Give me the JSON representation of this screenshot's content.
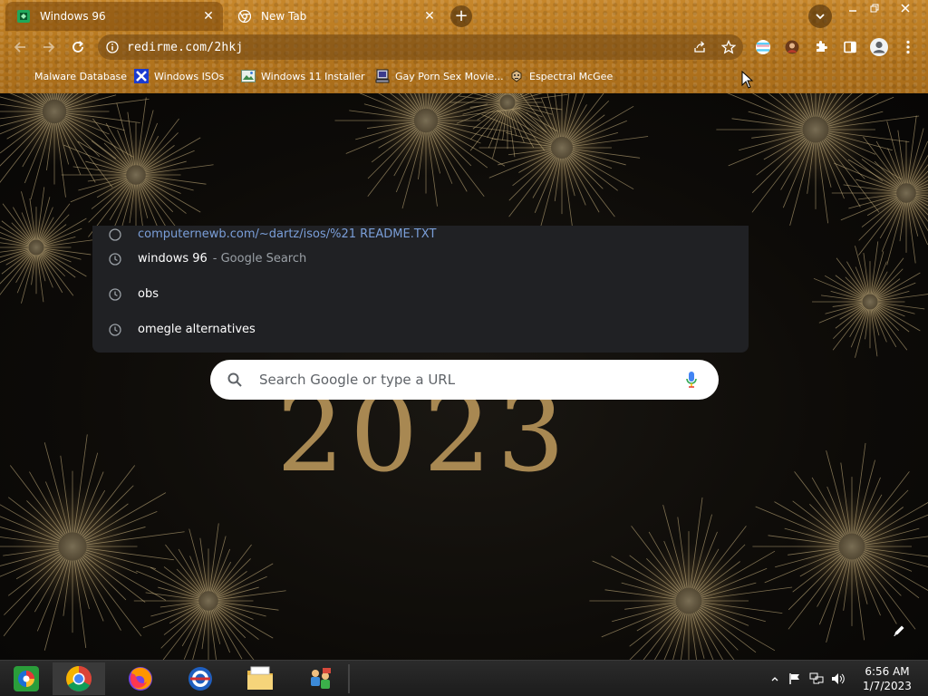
{
  "tabs": [
    {
      "title": "Windows 96",
      "active": true
    },
    {
      "title": "New Tab",
      "active": false
    }
  ],
  "toolbar": {
    "url": "redirme.com/2hkj"
  },
  "bookmarks": [
    {
      "label": "Malware Database"
    },
    {
      "label": "Windows ISOs"
    },
    {
      "label": "Windows 11 Installer"
    },
    {
      "label": "Gay Porn Sex Movie..."
    },
    {
      "label": "Espectral McGee"
    }
  ],
  "ntp": {
    "background_year": "2023",
    "search_placeholder": "Search Google or type a URL"
  },
  "suggestions": [
    {
      "text": "windows 96",
      "suffix": "- Google Search"
    },
    {
      "text": "obs",
      "suffix": ""
    },
    {
      "text": "omegle alternatives",
      "suffix": ""
    }
  ],
  "taskbar": {
    "time": "6:56 AM",
    "date": "1/7/2023"
  },
  "colors": {
    "chrome_theme": "#b7781f",
    "dropdown_bg": "#202124",
    "link_blue": "#8ab4f8",
    "year_gold": "#b8955a"
  }
}
